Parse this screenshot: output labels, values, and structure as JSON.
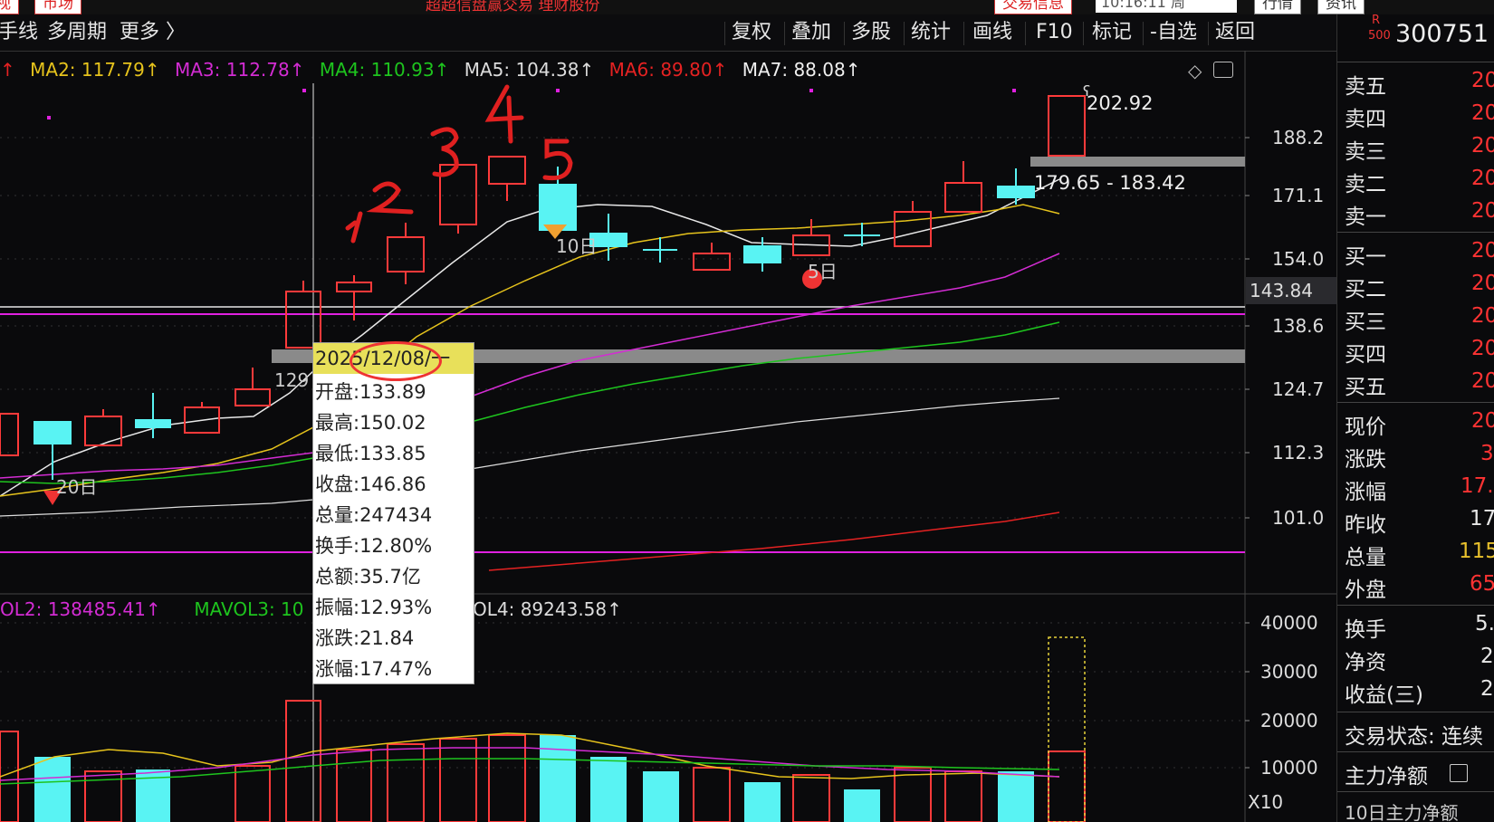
{
  "top": {
    "buttons": [
      "视",
      "市场",
      "交易信息",
      "行情",
      "资讯"
    ],
    "notice": "超超信盘赢交易 理财股份",
    "time": "10:16:11 周"
  },
  "toolbar": {
    "left": [
      "手线",
      "多周期",
      "更多 〉"
    ],
    "right": [
      "复权",
      "叠加",
      "多股",
      "统计",
      "画线",
      "F10",
      "标记",
      "-自选",
      "返回"
    ]
  },
  "ma_bar": [
    {
      "text": "MA2: 117.79↑",
      "color": "#e6c31c"
    },
    {
      "text": "MA3: 112.78↑",
      "color": "#d32cd3"
    },
    {
      "text": "MA4: 110.93↑",
      "color": "#1ec41e"
    },
    {
      "text": "MA5: 104.38↑",
      "color": "#dddddd"
    },
    {
      "text": "MA6: 89.80↑",
      "color": "#e52222"
    },
    {
      "text": "MA7: 88.08↑",
      "color": "#f0f0f0"
    }
  ],
  "vol_bar": [
    {
      "text": "OL2: 138485.41↑",
      "color": "#d32cd3"
    },
    {
      "text": "MAVOL3: 10",
      "color": "#1ec41e"
    },
    {
      "text": "OL4: 89243.58↑",
      "color": "#dddddd"
    }
  ],
  "price_axis": [
    "188.2",
    "171.1",
    "154.0",
    "143.84",
    "138.6",
    "124.7",
    "112.3",
    "101.0"
  ],
  "volume_axis": [
    "40000",
    "30000",
    "20000",
    "10000"
  ],
  "volume_scale": "X10",
  "annotations": {
    "max_price": "202.92",
    "range": "179.65 - 183.42",
    "price_129": "129",
    "d20": "20日",
    "d10": "10日",
    "d5": "5日",
    "hand_numbers": [
      "1",
      "2",
      "3",
      "4",
      "5"
    ]
  },
  "tooltip": {
    "date": "2025/12/08/一",
    "lines": [
      "开盘:133.89",
      "最高:150.02",
      "最低:133.85",
      "收盘:146.86",
      "总量:247434",
      "换手:12.80%",
      "总额:35.7亿",
      "振幅:12.93%",
      "涨跌:21.84",
      "涨幅:17.47%"
    ]
  },
  "right_panel": {
    "code": "300751",
    "badge_r": "R",
    "badge_500": "500",
    "sells": [
      "卖五",
      "卖四",
      "卖三",
      "卖二",
      "卖一"
    ],
    "buys": [
      "买一",
      "买二",
      "买三",
      "买四",
      "买五"
    ],
    "book_values": [
      "20",
      "20",
      "20",
      "20",
      "20",
      "20",
      "20",
      "20",
      "20",
      "20"
    ],
    "stats": [
      {
        "label": "现价",
        "value": "20",
        "color": "#ff3333"
      },
      {
        "label": "涨跌",
        "value": "3",
        "color": "#ff3333"
      },
      {
        "label": "涨幅",
        "value": "17.",
        "color": "#ff3333"
      },
      {
        "label": "昨收",
        "value": "17",
        "color": "#e8e8e8"
      },
      {
        "label": "总量",
        "value": "115",
        "color": "#e8c02c"
      },
      {
        "label": "外盘",
        "value": "65",
        "color": "#ff3333"
      }
    ],
    "stats2": [
      {
        "label": "换手",
        "value": "5."
      },
      {
        "label": "净资",
        "value": "2"
      },
      {
        "label": "收益(三)",
        "value": "2"
      }
    ],
    "trade_status": "交易状态: 连续",
    "main_flow": "主力净额",
    "bottom_cut": "10日主力净额"
  }
}
